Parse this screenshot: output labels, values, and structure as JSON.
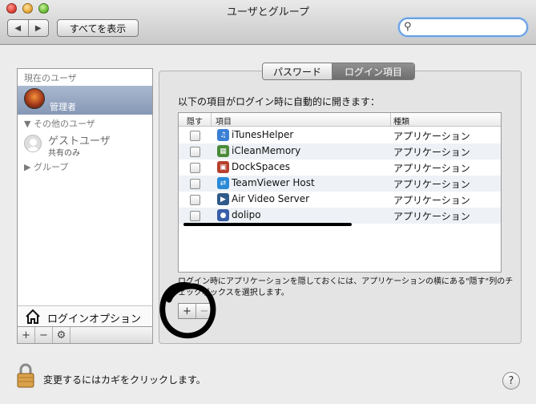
{
  "window": {
    "title": "ユーザとグループ"
  },
  "toolbar": {
    "back": "◀",
    "forward": "▶",
    "show_all": "すべてを表示",
    "search_value": ""
  },
  "sidebar": {
    "current_section": "現在のユーザ",
    "current_user_role": "管理者",
    "other_section": "▼ その他のユーザ",
    "guest_name": "ゲストユーザ",
    "guest_sub": "共有のみ",
    "group": "▶ グループ",
    "login_options": "ログインオプション",
    "add": "+",
    "remove": "−",
    "action": "⚙"
  },
  "tabs": {
    "password": "パスワード",
    "login_items": "ログイン項目"
  },
  "main": {
    "intro": "以下の項目がログイン時に自動的に開きます：",
    "columns": {
      "hide": "隠す",
      "item": "項目",
      "kind": "種類"
    },
    "items": [
      {
        "name": "iTunesHelper",
        "kind": "アプリケーション",
        "icon": "itunes-icon",
        "color": "#3a7fd4"
      },
      {
        "name": "iCleanMemory",
        "kind": "アプリケーション",
        "icon": "clean-memory-icon",
        "color": "#4a8a3a"
      },
      {
        "name": "DockSpaces",
        "kind": "アプリケーション",
        "icon": "dockspaces-icon",
        "color": "#b8402e"
      },
      {
        "name": "TeamViewer Host",
        "kind": "アプリケーション",
        "icon": "teamviewer-icon",
        "color": "#2a8ad8"
      },
      {
        "name": "Air Video Server",
        "kind": "アプリケーション",
        "icon": "air-video-icon",
        "color": "#2f5a8a"
      },
      {
        "name": "dolipo",
        "kind": "アプリケーション",
        "icon": "dolipo-icon",
        "color": "#3a5ea8"
      }
    ],
    "hint": "ログイン時にアプリケーションを隠しておくには、アプリケーションの横にある\"隠す\"列のチェックボックスを選択します。",
    "add": "+",
    "remove": "−"
  },
  "footer": {
    "lock_text": "変更するにはカギをクリックします。",
    "help": "?"
  }
}
